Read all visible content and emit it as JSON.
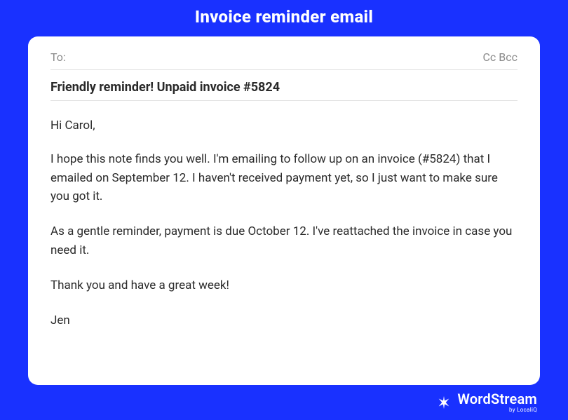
{
  "header": {
    "title": "Invoice reminder email"
  },
  "email": {
    "to_label": "To:",
    "cc_bcc": "Cc Bcc",
    "subject": "Friendly reminder! Unpaid invoice #5824",
    "body": {
      "greeting": "Hi Carol,",
      "para1": "I hope this note finds you well. I'm emailing to follow up on an invoice (#5824) that I emailed on September 12. I haven't received  payment yet, so I just want to make sure you got it.",
      "para2": "As a gentle reminder, payment is due October 12. I've reattached the invoice in case you need it.",
      "closing": "Thank you and have a great week!",
      "signature": "Jen"
    }
  },
  "footer": {
    "brand_name": "WordStream",
    "brand_sub": "by LocaliQ"
  }
}
